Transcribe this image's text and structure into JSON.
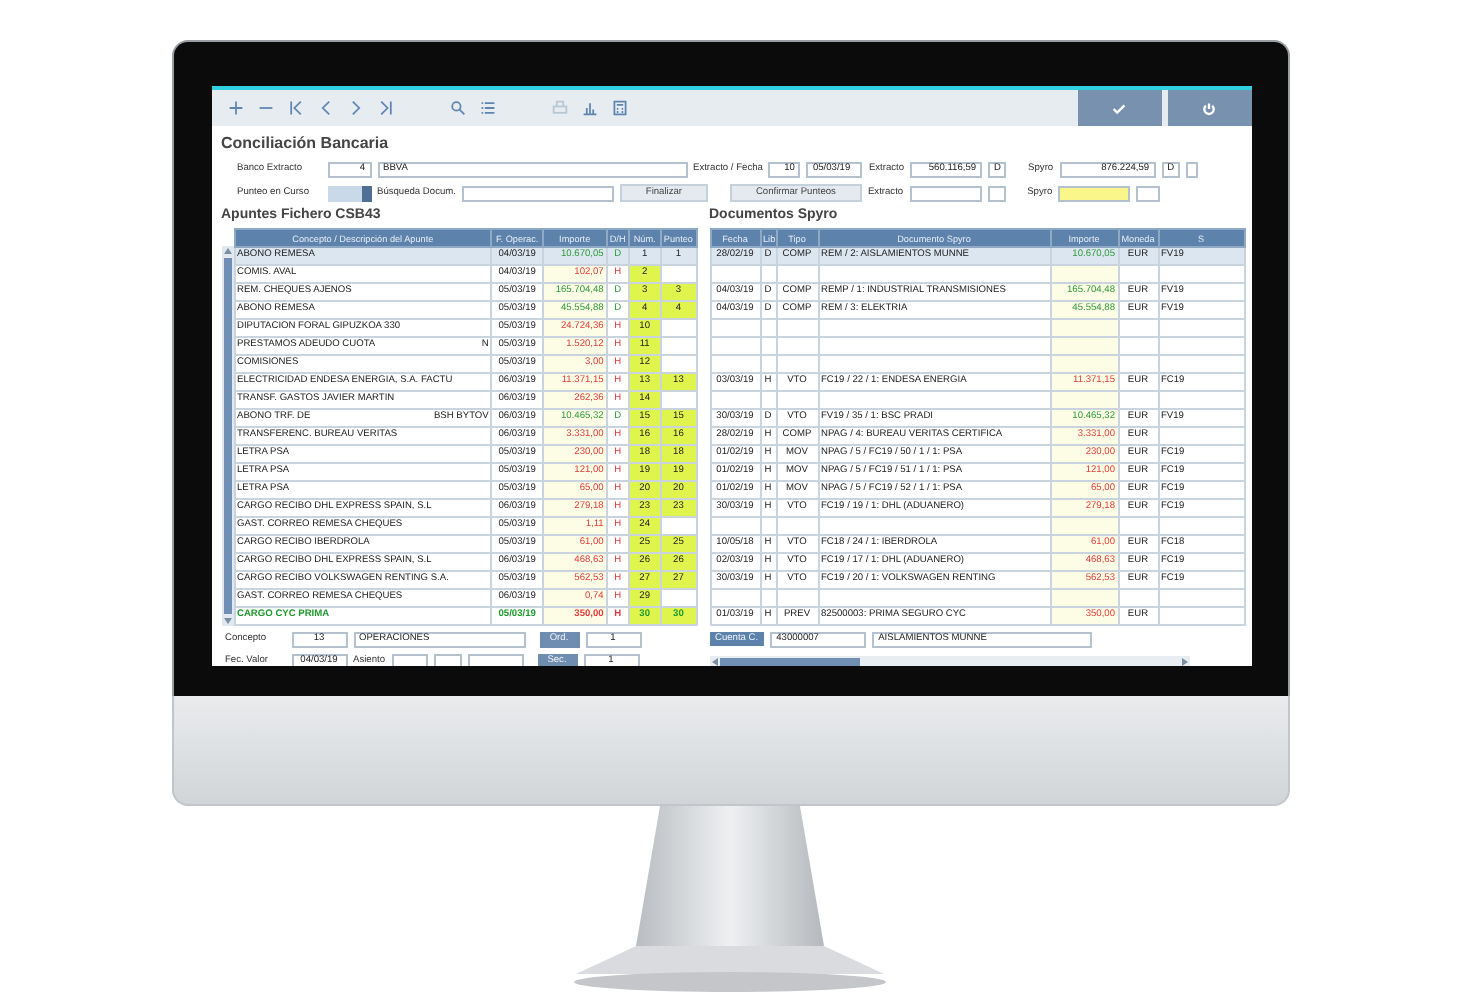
{
  "title": "Conciliación Bancaria",
  "bank": {
    "label": "Banco Extracto",
    "code": "4",
    "name": "BBVA"
  },
  "statement": {
    "label": "Extracto / Fecha",
    "number": "10",
    "date": "05/03/19"
  },
  "balance_statement": {
    "label": "Extracto",
    "amount": "560.116,59",
    "dh": "D"
  },
  "balance_spyro": {
    "label": "Spyro",
    "amount": "876.224,59",
    "dh": "D"
  },
  "punteo": {
    "label": "Punteo en Curso"
  },
  "search": {
    "label": "Búsqueda Docum."
  },
  "buttons": [
    "Finalizar",
    "Confirmar Punteos"
  ],
  "diff_statement": {
    "label": "Extracto"
  },
  "diff_spyro": {
    "label": "Spyro"
  },
  "csb43": {
    "title": "Apuntes Fichero CSB43",
    "columns": [
      "Concepto / Descripción del Apunte",
      "F. Operac.",
      "Importe",
      "D/H",
      "Núm.",
      "Punteo"
    ],
    "rows": [
      {
        "concept": "ABONO REMESA",
        "date": "04/03/19",
        "amount": "10.670,05",
        "dh": "D",
        "num": "1",
        "punteo": "1",
        "selected": true,
        "highlighted": false
      },
      {
        "concept": "COMIS. AVAL",
        "date": "04/03/19",
        "amount": "102,07",
        "dh": "H",
        "num": "2",
        "selected": false,
        "highlighted": false
      },
      {
        "concept": "REM. CHEQUES AJENOS",
        "date": "05/03/19",
        "amount": "165.704,48",
        "dh": "D",
        "num": "3",
        "punteo": "3",
        "selected": false,
        "highlighted": false
      },
      {
        "concept": "ABONO REMESA",
        "date": "05/03/19",
        "amount": "45.554,88",
        "dh": "D",
        "num": "4",
        "punteo": "4",
        "selected": false,
        "highlighted": false
      },
      {
        "concept": "DIPUTACION FORAL GIPUZKOA 330",
        "date": "05/03/19",
        "amount": "24.724,36",
        "dh": "H",
        "num": "10",
        "selected": false,
        "highlighted": false
      },
      {
        "concept": "PRESTAMOS ADEUDO CUOTA",
        "extra": "N",
        "date": "05/03/19",
        "amount": "1.520,12",
        "dh": "H",
        "num": "11",
        "selected": false,
        "highlighted": false
      },
      {
        "concept": "COMISIONES",
        "date": "05/03/19",
        "amount": "3,00",
        "dh": "H",
        "num": "12",
        "selected": false,
        "highlighted": false
      },
      {
        "concept": "ELECTRICIDAD ENDESA ENERGIA, S.A. FACTU",
        "date": "06/03/19",
        "amount": "11.371,15",
        "dh": "H",
        "num": "13",
        "punteo": "13",
        "selected": false,
        "highlighted": false
      },
      {
        "concept": "TRANSF.   GASTOS JAVIER MARTIN",
        "date": "06/03/19",
        "amount": "262,36",
        "dh": "H",
        "num": "14",
        "selected": false,
        "highlighted": false
      },
      {
        "concept": "ABONO TRF. DE",
        "extra": "BSH BYTOV",
        "date": "06/03/19",
        "amount": "10.465,32",
        "dh": "D",
        "num": "15",
        "punteo": "15",
        "selected": false,
        "highlighted": false
      },
      {
        "concept": "TRANSFERENC. BUREAU VERITAS",
        "date": "06/03/19",
        "amount": "3.331,00",
        "dh": "H",
        "num": "16",
        "punteo": "16",
        "selected": false,
        "highlighted": false
      },
      {
        "concept": "LETRA PSA",
        "date": "05/03/19",
        "amount": "230,00",
        "dh": "H",
        "num": "18",
        "punteo": "18",
        "selected": false,
        "highlighted": false
      },
      {
        "concept": "LETRA PSA",
        "date": "05/03/19",
        "amount": "121,00",
        "dh": "H",
        "num": "19",
        "punteo": "19",
        "selected": false,
        "highlighted": false
      },
      {
        "concept": "LETRA PSA",
        "date": "05/03/19",
        "amount": "65,00",
        "dh": "H",
        "num": "20",
        "punteo": "20",
        "selected": false,
        "highlighted": false
      },
      {
        "concept": "CARGO RECIBO DHL EXPRESS SPAIN, S.L",
        "date": "06/03/19",
        "amount": "279,18",
        "dh": "H",
        "num": "23",
        "punteo": "23",
        "selected": false,
        "highlighted": false
      },
      {
        "concept": "GAST. CORREO REMESA CHEQUES",
        "date": "05/03/19",
        "amount": "1,11",
        "dh": "H",
        "num": "24",
        "selected": false,
        "highlighted": false
      },
      {
        "concept": "CARGO RECIBO IBERDROLA",
        "date": "05/03/19",
        "amount": "61,00",
        "dh": "H",
        "num": "25",
        "punteo": "25",
        "selected": false,
        "highlighted": false
      },
      {
        "concept": "CARGO RECIBO DHL EXPRESS SPAIN, S.L",
        "date": "06/03/19",
        "amount": "468,63",
        "dh": "H",
        "num": "26",
        "punteo": "26",
        "selected": false,
        "highlighted": false
      },
      {
        "concept": "CARGO RECIBO VOLKSWAGEN RENTING S.A.",
        "date": "05/03/19",
        "amount": "562,53",
        "dh": "H",
        "num": "27",
        "punteo": "27",
        "selected": false,
        "highlighted": false
      },
      {
        "concept": "GAST. CORREO REMESA CHEQUES",
        "date": "06/03/19",
        "amount": "0,74",
        "dh": "H",
        "num": "29",
        "selected": false,
        "highlighted": false
      },
      {
        "concept": "CARGO CYC PRIMA",
        "date": "05/03/19",
        "amount": "350,00",
        "dh": "H",
        "num": "30",
        "punteo": "30",
        "selected": false,
        "highlighted": true
      }
    ]
  },
  "concept": {
    "label": "Concepto",
    "code": "13",
    "name": "OPERACIONES"
  },
  "ord": {
    "label": "Ord.",
    "value": "1"
  },
  "value_date": {
    "label": "Fec. Valor",
    "value": "04/03/19"
  },
  "asiento": {
    "label": "Asiento"
  },
  "sec": {
    "label": "Sec.",
    "value": "1"
  },
  "spyro": {
    "title": "Documentos Spyro",
    "columns": [
      "Fecha",
      "Lib",
      "Tipo",
      "Documento Spyro",
      "Importe",
      "Moneda",
      "S"
    ],
    "rows": [
      {
        "kind": "entry",
        "date": "28/02/19",
        "dh": "D",
        "type": "COMP",
        "doc": "REM / 2: AISLAMIENTOS MUNNE",
        "amount": "10.670,05",
        "currency": "EUR",
        "series": "FV19",
        "selected": true
      },
      {
        "kind": "blank",
        "selected": false
      },
      {
        "kind": "entry",
        "date": "04/03/19",
        "dh": "D",
        "type": "COMP",
        "doc": "REMP / 1: INDUSTRIAL TRANSMISIONES",
        "amount": "165.704,48",
        "currency": "EUR",
        "series": "FV19",
        "selected": false
      },
      {
        "kind": "entry",
        "date": "04/03/19",
        "dh": "D",
        "type": "COMP",
        "doc": "REM / 3: ELEKTRIA",
        "amount": "45.554,88",
        "currency": "EUR",
        "series": "FV19",
        "selected": false
      },
      {
        "kind": "blank",
        "selected": false
      },
      {
        "kind": "blank",
        "selected": false
      },
      {
        "kind": "blank",
        "selected": false
      },
      {
        "kind": "entry",
        "date": "03/03/19",
        "dh": "H",
        "type": "VTO",
        "doc": "FC19 / 22 / 1: ENDESA ENERGIA",
        "amount": "11.371,15",
        "currency": "EUR",
        "series": "FC19",
        "selected": false
      },
      {
        "kind": "blank",
        "selected": false
      },
      {
        "kind": "entry",
        "date": "30/03/19",
        "dh": "D",
        "type": "VTO",
        "doc": "FV19 / 35 / 1: BSC PRADI",
        "amount": "10.465,32",
        "currency": "EUR",
        "series": "FV19",
        "selected": false
      },
      {
        "kind": "entry",
        "date": "28/02/19",
        "dh": "H",
        "type": "COMP",
        "doc": "NPAG / 4: BUREAU VERITAS CERTIFICA",
        "amount": "3.331,00",
        "currency": "EUR",
        "selected": false
      },
      {
        "kind": "entry",
        "date": "01/02/19",
        "dh": "H",
        "type": "MOV",
        "doc": "NPAG / 5 / FC19 / 50 / 1 / 1: PSA",
        "amount": "230,00",
        "currency": "EUR",
        "series": "FC19",
        "selected": false
      },
      {
        "kind": "entry",
        "date": "01/02/19",
        "dh": "H",
        "type": "MOV",
        "doc": "NPAG / 5 / FC19 / 51 / 1 / 1: PSA",
        "amount": "121,00",
        "currency": "EUR",
        "series": "FC19",
        "selected": false
      },
      {
        "kind": "entry",
        "date": "01/02/19",
        "dh": "H",
        "type": "MOV",
        "doc": "NPAG / 5 / FC19 / 52 / 1 / 1: PSA",
        "amount": "65,00",
        "currency": "EUR",
        "series": "FC19",
        "selected": false
      },
      {
        "kind": "entry",
        "date": "30/03/19",
        "dh": "H",
        "type": "VTO",
        "doc": "FC19 / 19 / 1: DHL (ADUANERO)",
        "amount": "279,18",
        "currency": "EUR",
        "series": "FC19",
        "selected": false
      },
      {
        "kind": "blank",
        "selected": false
      },
      {
        "kind": "entry",
        "date": "10/05/18",
        "dh": "H",
        "type": "VTO",
        "doc": "FC18 / 24 / 1: IBERDROLA",
        "amount": "61,00",
        "currency": "EUR",
        "series": "FC18",
        "selected": false
      },
      {
        "kind": "entry",
        "date": "02/03/19",
        "dh": "H",
        "type": "VTO",
        "doc": "FC19 / 17 / 1: DHL (ADUANERO)",
        "amount": "468,63",
        "currency": "EUR",
        "series": "FC19",
        "selected": false
      },
      {
        "kind": "entry",
        "date": "30/03/19",
        "dh": "H",
        "type": "VTO",
        "doc": "FC19 / 20 / 1: VOLKSWAGEN RENTING",
        "amount": "562,53",
        "currency": "EUR",
        "series": "FC19",
        "selected": false
      },
      {
        "kind": "blank",
        "selected": false
      },
      {
        "kind": "entry",
        "date": "01/03/19",
        "dh": "H",
        "type": "PREV",
        "doc": "82500003: PRIMA SEGURO CYC",
        "amount": "350,00",
        "currency": "EUR",
        "selected": false
      }
    ]
  },
  "account": {
    "label": "Cuenta C.",
    "code": "43000007",
    "name": "AISLAMIENTOS MUNNE"
  }
}
